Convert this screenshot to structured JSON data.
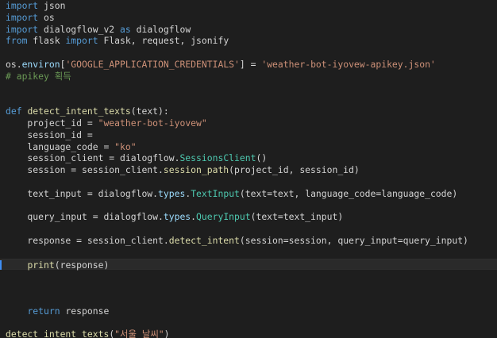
{
  "editor": {
    "colors": {
      "background": "#1e1e1e",
      "keyword": "#569cd6",
      "string": "#ce9178",
      "comment": "#6a9955",
      "function": "#dcdcaa",
      "class": "#4ec9b0",
      "variable": "#9cdcfe",
      "plain": "#d4d4d4",
      "caret": "#3f8ef5"
    },
    "current_line": 22,
    "lines": [
      [
        {
          "t": "kw",
          "v": "import"
        },
        {
          "t": "plain",
          "v": " json"
        }
      ],
      [
        {
          "t": "kw",
          "v": "import"
        },
        {
          "t": "plain",
          "v": " os"
        }
      ],
      [
        {
          "t": "kw",
          "v": "import"
        },
        {
          "t": "plain",
          "v": " dialogflow_v2 "
        },
        {
          "t": "kw",
          "v": "as"
        },
        {
          "t": "plain",
          "v": " dialogflow"
        }
      ],
      [
        {
          "t": "kw",
          "v": "from"
        },
        {
          "t": "plain",
          "v": " flask "
        },
        {
          "t": "kw",
          "v": "import"
        },
        {
          "t": "plain",
          "v": " Flask, request, jsonify"
        }
      ],
      [],
      [
        {
          "t": "plain",
          "v": "os."
        },
        {
          "t": "var",
          "v": "environ"
        },
        {
          "t": "plain",
          "v": "["
        },
        {
          "t": "str",
          "v": "'GOOGLE_APPLICATION_CREDENTIALS'"
        },
        {
          "t": "plain",
          "v": "] = "
        },
        {
          "t": "str",
          "v": "'weather-bot-iyovew-apikey.json'"
        }
      ],
      [
        {
          "t": "cmt",
          "v": "# apikey 획득"
        }
      ],
      [],
      [],
      [
        {
          "t": "kw",
          "v": "def"
        },
        {
          "t": "plain",
          "v": " "
        },
        {
          "t": "fn",
          "v": "detect_intent_texts"
        },
        {
          "t": "plain",
          "v": "(text):"
        }
      ],
      [
        {
          "t": "plain",
          "v": "    project_id = "
        },
        {
          "t": "str",
          "v": "\"weather-bot-iyovew\""
        }
      ],
      [
        {
          "t": "plain",
          "v": "    session_id ="
        }
      ],
      [
        {
          "t": "plain",
          "v": "    language_code = "
        },
        {
          "t": "str",
          "v": "\"ko\""
        }
      ],
      [
        {
          "t": "plain",
          "v": "    session_client = dialogflow."
        },
        {
          "t": "cls",
          "v": "SessionsClient"
        },
        {
          "t": "plain",
          "v": "()"
        }
      ],
      [
        {
          "t": "plain",
          "v": "    session = session_client."
        },
        {
          "t": "fn",
          "v": "session_path"
        },
        {
          "t": "plain",
          "v": "(project_id, session_id)"
        }
      ],
      [],
      [
        {
          "t": "plain",
          "v": "    text_input = dialogflow."
        },
        {
          "t": "var",
          "v": "types"
        },
        {
          "t": "plain",
          "v": "."
        },
        {
          "t": "cls",
          "v": "TextInput"
        },
        {
          "t": "plain",
          "v": "(text=text, language_code=language_code)"
        }
      ],
      [],
      [
        {
          "t": "plain",
          "v": "    query_input = dialogflow."
        },
        {
          "t": "var",
          "v": "types"
        },
        {
          "t": "plain",
          "v": "."
        },
        {
          "t": "cls",
          "v": "QueryInput"
        },
        {
          "t": "plain",
          "v": "(text=text_input)"
        }
      ],
      [],
      [
        {
          "t": "plain",
          "v": "    response = session_client."
        },
        {
          "t": "fn",
          "v": "detect_intent"
        },
        {
          "t": "plain",
          "v": "(session=session, query_input=query_input)"
        }
      ],
      [],
      [
        {
          "t": "plain",
          "v": "    "
        },
        {
          "t": "fn",
          "v": "print"
        },
        {
          "t": "plain",
          "v": "(response)"
        }
      ],
      [],
      [],
      [],
      [
        {
          "t": "plain",
          "v": "    "
        },
        {
          "t": "kw",
          "v": "return"
        },
        {
          "t": "plain",
          "v": " response"
        }
      ],
      [],
      [
        {
          "t": "fn",
          "v": "detect_intent_texts"
        },
        {
          "t": "plain",
          "v": "("
        },
        {
          "t": "str",
          "v": "\"서울 날씨\""
        },
        {
          "t": "plain",
          "v": ")"
        }
      ]
    ]
  }
}
